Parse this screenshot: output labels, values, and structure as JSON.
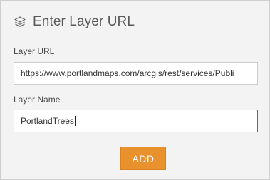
{
  "header": {
    "icon": "layers-icon",
    "title": "Enter Layer URL"
  },
  "form": {
    "url_label": "Layer URL",
    "url_value": "https://www.portlandmaps.com/arcgis/rest/services/Publi",
    "name_label": "Layer Name",
    "name_value": "PortlandTrees"
  },
  "actions": {
    "add_label": "ADD"
  },
  "colors": {
    "accent": "#e8912d",
    "panel_bg": "#f3f3f3",
    "focus_border": "#4b6f96"
  }
}
